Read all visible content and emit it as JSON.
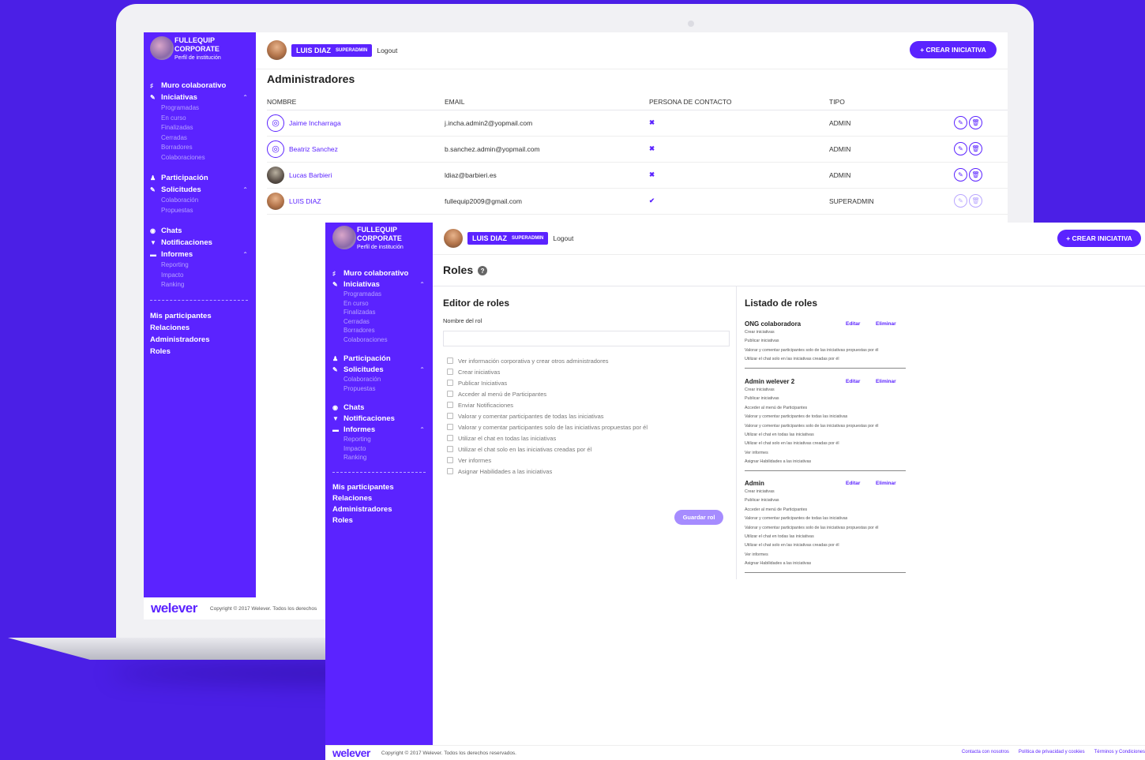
{
  "brand": {
    "name_line1": "FULLEQUIP",
    "name_line2": "CORPORATE",
    "subtitle": "Perfil de institución",
    "logo_word": "welever"
  },
  "user": {
    "name": "LUIS DIAZ",
    "role": "SUPERADMIN",
    "logout": "Logout"
  },
  "create_button": "+  CREAR INICIATIVA",
  "sidebar": {
    "muro": "Muro colaborativo",
    "iniciativas": "Iniciativas",
    "iniciativas_sub": [
      "Programadas",
      "En curso",
      "Finalizadas",
      "Cerradas",
      "Borradores",
      "Colaboraciones"
    ],
    "participacion": "Participación",
    "solicitudes": "Solicitudes",
    "solicitudes_sub": [
      "Colaboración",
      "Propuestas"
    ],
    "chats": "Chats",
    "notificaciones": "Notificaciones",
    "informes": "Informes",
    "informes_sub": [
      "Reporting",
      "Impacto",
      "Ranking"
    ],
    "bottom": [
      "Mis participantes",
      "Relaciones",
      "Administradores",
      "Roles"
    ]
  },
  "admins": {
    "title": "Administradores",
    "columns": [
      "NOMBRE",
      "EMAIL",
      "PERSONA DE CONTACTO",
      "TIPO"
    ],
    "rows": [
      {
        "name": "Jaime Incharraga",
        "email": "j.incha.admin2@yopmail.com",
        "contact": "✖",
        "type": "ADMIN"
      },
      {
        "name": "Beatriz Sanchez",
        "email": "b.sanchez.admin@yopmail.com",
        "contact": "✖",
        "type": "ADMIN"
      },
      {
        "name": "Lucas Barbieri",
        "email": "ldiaz@barbieri.es",
        "contact": "✖",
        "type": "ADMIN"
      },
      {
        "name": "LUIS DIAZ",
        "email": "fullequip2009@gmail.com",
        "contact": "✔",
        "type": "SUPERADMIN"
      }
    ]
  },
  "copyright_back": "Copyright © 2017 Welever. Todos los derechos",
  "roles": {
    "title": "Roles",
    "editor_title": "Editor de roles",
    "name_label": "Nombre del rol",
    "permissions": [
      "Ver información corporativa y crear otros administradores",
      "Crear iniciativas",
      "Publicar Iniciativas",
      "Acceder al menú de Participantes",
      "Enviar Notificaciones",
      "Valorar y comentar participantes de todas las iniciativas",
      "Valorar y comentar participantes solo de las iniciativas propuestas por él",
      "Utilizar el chat en todas las iniciativas",
      "Utilizar el chat solo en las iniciativas creadas por él",
      "Ver informes",
      "Asignar Habilidades a las iniciativas"
    ],
    "save_button": "Guardar rol",
    "list_title": "Listado de roles",
    "edit_label": "Editar",
    "delete_label": "Eliminar",
    "list": [
      {
        "name": "ONG colaboradora",
        "perms": [
          "Crear iniciativas",
          "Publicar iniciativas",
          "Valorar y comentar participantes solo de las iniciativas propuestas por él",
          "Utilizar el chat solo en las iniciativas creadas por él"
        ]
      },
      {
        "name": "Admin welever 2",
        "perms": [
          "Crear iniciativas",
          "Publicar iniciativas",
          "Acceder al menú de Participantes",
          "Valorar y comentar participantes de todas las iniciativas",
          "Valorar y comentar participantes solo de las iniciativas propuestas por él",
          "Utilizar el chat en todas las iniciativas",
          "Utilizar el chat solo en las iniciativas creadas por él",
          "Ver informes",
          "Asignar Habilidades a las iniciativas"
        ]
      },
      {
        "name": "Admin",
        "perms": [
          "Crear iniciativas",
          "Publicar iniciativas",
          "Acceder al menú de Participantes",
          "Valorar y comentar participantes de todas las iniciativas",
          "Valorar y comentar participantes solo de las iniciativas propuestas por él",
          "Utilizar el chat en todas las iniciativas",
          "Utilizar el chat solo en las iniciativas creadas por él",
          "Ver informes",
          "Asignar Habilidades a las iniciativas"
        ]
      }
    ]
  },
  "footer": {
    "copyright": "Copyright © 2017 Welever. Todos los derechos reservados.",
    "links": [
      "Contacta con nosotros",
      "Política de privacidad y cookies",
      "Términos y Condiciones"
    ]
  },
  "colors": {
    "background": "#4b1fe6",
    "sidebar": "#5b23ff",
    "accent": "#5b23ff"
  }
}
